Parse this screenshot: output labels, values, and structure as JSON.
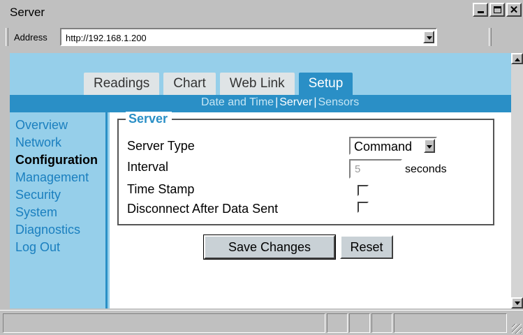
{
  "window": {
    "title": "Server"
  },
  "address_bar": {
    "label": "Address",
    "url": "http://192.168.1.200"
  },
  "tabs": [
    {
      "label": "Readings",
      "active": false
    },
    {
      "label": "Chart",
      "active": false
    },
    {
      "label": "Web Link",
      "active": false
    },
    {
      "label": "Setup",
      "active": true
    }
  ],
  "subnav": {
    "items": [
      {
        "label": "Date and Time",
        "active": false
      },
      {
        "label": "Server",
        "active": true
      },
      {
        "label": "Sensors",
        "active": false
      }
    ],
    "separator": "|"
  },
  "sidebar": {
    "items": [
      {
        "label": "Overview",
        "active": false
      },
      {
        "label": "Network",
        "active": false
      },
      {
        "label": "Configuration",
        "active": true
      },
      {
        "label": "Management",
        "active": false
      },
      {
        "label": "Security",
        "active": false
      },
      {
        "label": "System",
        "active": false
      },
      {
        "label": "Diagnostics",
        "active": false
      },
      {
        "label": "Log Out",
        "active": false
      }
    ]
  },
  "server_form": {
    "legend": "Server",
    "server_type": {
      "label": "Server Type",
      "value": "Command"
    },
    "interval": {
      "label": "Interval",
      "value": "5",
      "unit": "seconds"
    },
    "time_stamp": {
      "label": "Time Stamp",
      "checked": false
    },
    "disconnect_after_data_sent": {
      "label": "Disconnect After Data Sent",
      "checked": false
    },
    "buttons": {
      "save": "Save Changes",
      "reset": "Reset"
    }
  },
  "icons": {
    "minimize": "minimize-icon",
    "maximize": "maximize-icon",
    "close": "close-icon",
    "dropdown": "chevron-down-icon",
    "scroll_up": "scroll-up-icon",
    "scroll_down": "scroll-down-icon"
  },
  "colors": {
    "accent": "#2a8fc6",
    "panel": "#96cfea",
    "link": "#1a7fbf",
    "chrome": "#c0c0c0"
  }
}
